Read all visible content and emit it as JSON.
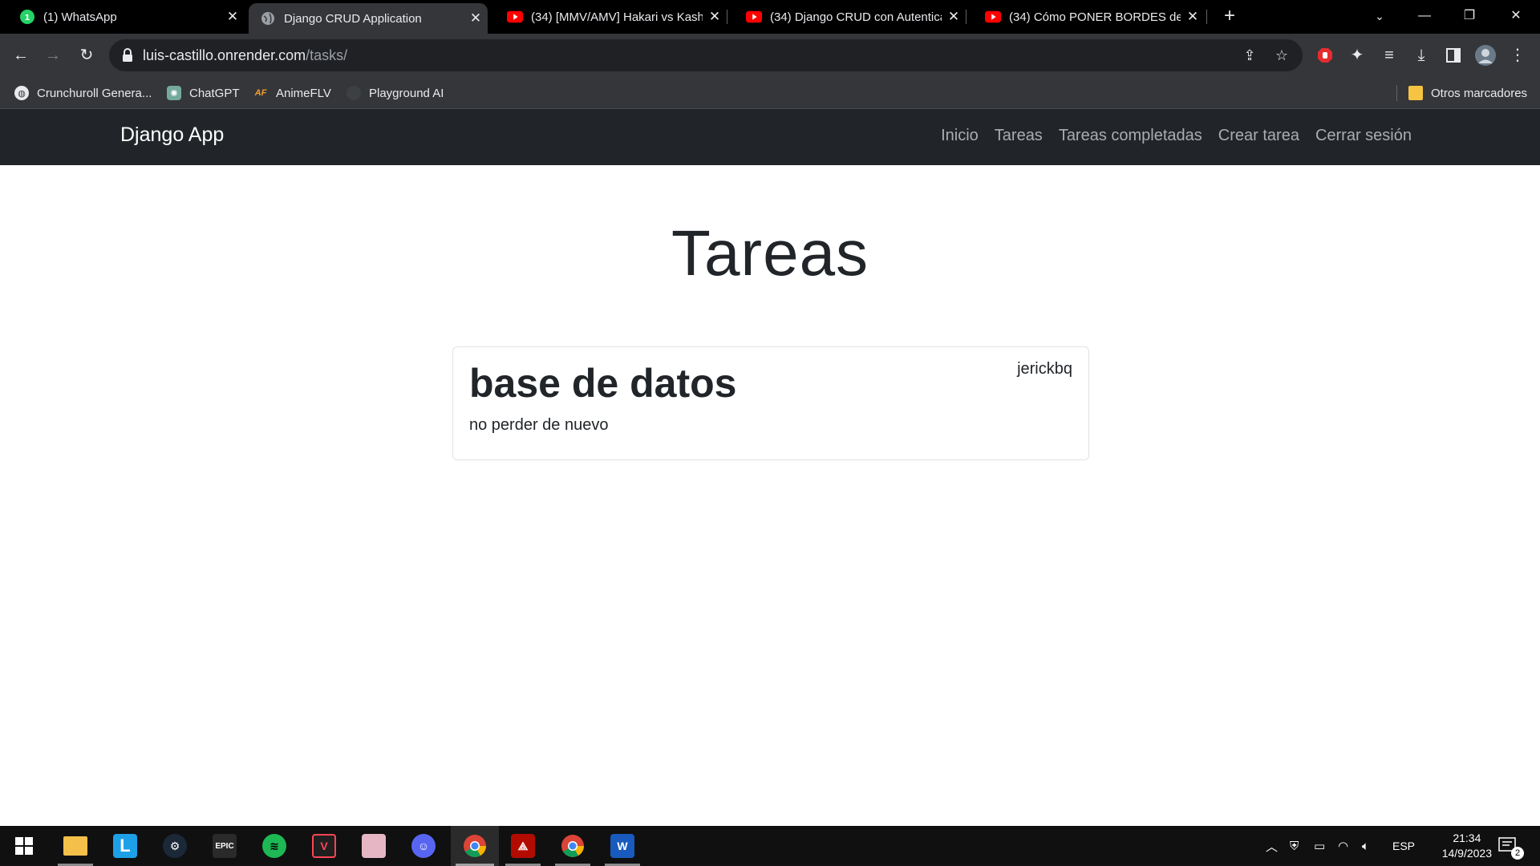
{
  "tabs": [
    {
      "title": "(1) WhatsApp",
      "icon": "whatsapp-icon",
      "color": "#25d366"
    },
    {
      "title": "Django CRUD Application",
      "icon": "globe-icon",
      "color": "#9aa0a6"
    },
    {
      "title": "(34) [MMV/AMV] Hakari vs Kash",
      "icon": "youtube-icon",
      "color": "#ff0000"
    },
    {
      "title": "(34) Django CRUD con Autentica",
      "icon": "youtube-icon",
      "color": "#ff0000"
    },
    {
      "title": "(34) Cómo PONER BORDES de P",
      "icon": "youtube-icon",
      "color": "#ff0000"
    }
  ],
  "active_tab": 1,
  "address": {
    "host": "luis-castillo.onrender.com",
    "path": "/tasks/"
  },
  "bookmarks": [
    {
      "label": "Crunchuroll Genera...",
      "icon": "globe-icon"
    },
    {
      "label": "ChatGPT",
      "icon": "chatgpt-icon"
    },
    {
      "label": "AnimeFLV",
      "icon": "animeflv-icon"
    },
    {
      "label": "Playground AI",
      "icon": "playground-icon"
    }
  ],
  "other_bookmarks": "Otros marcadores",
  "navbar": {
    "brand": "Django App",
    "links": [
      "Inicio",
      "Tareas",
      "Tareas completadas",
      "Crear tarea",
      "Cerrar sesión"
    ]
  },
  "page": {
    "title": "Tareas",
    "tasks": [
      {
        "title": "base de datos",
        "user": "jerickbq",
        "description": "no perder de nuevo"
      }
    ]
  },
  "taskbar": {
    "apps": [
      "windows-start-icon",
      "file-explorer-icon",
      "l-app-icon",
      "steam-icon",
      "epic-games-icon",
      "spotify-icon",
      "valorant-icon",
      "anime-app-icon",
      "discord-icon",
      "chrome-icon",
      "acrobat-icon",
      "chrome-profile-icon",
      "word-icon"
    ],
    "language": "ESP",
    "time": "21:34",
    "date": "14/9/2023",
    "notifications": "2"
  }
}
